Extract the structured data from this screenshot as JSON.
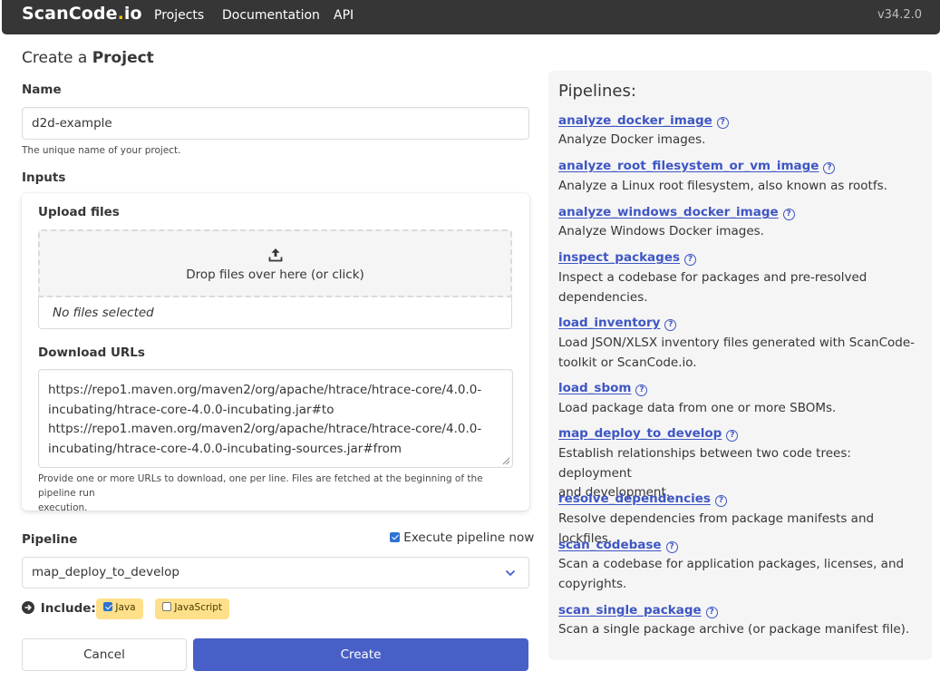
{
  "navbar": {
    "brand_main": "ScanCode",
    "brand_dot": ".",
    "brand_suffix": "io",
    "links": [
      "Projects",
      "Documentation",
      "API"
    ],
    "version": "v34.2.0"
  },
  "page": {
    "title_prefix": "Create a",
    "title_bold": "Project"
  },
  "form": {
    "name_label": "Name",
    "name_value": "d2d-example",
    "name_help": "The unique name of your project.",
    "inputs_label": "Inputs",
    "upload_label": "Upload files",
    "drop_text": "Drop files over here (or click)",
    "no_files": "No files selected",
    "download_label": "Download URLs",
    "urls_lines": [
      "https://repo1.maven.org/maven2/org/apache/htrace/htrace-core/4.0.0-",
      "incubating/htrace-core-4.0.0-incubating.jar#to",
      "https://repo1.maven.org/maven2/org/apache/htrace/htrace-core/4.0.0-",
      "incubating/htrace-core-4.0.0-incubating-sources.jar#from"
    ],
    "urls_help_1": "Provide one or more URLs to download, one per line. Files are fetched at the beginning of the pipeline run",
    "urls_help_2": "execution.",
    "pipeline_label": "Pipeline",
    "execute_label": "Execute pipeline now",
    "execute_checked": true,
    "pipeline_selected": "map_deploy_to_develop",
    "include_label": "Include:",
    "include_options": [
      {
        "label": "Java",
        "checked": true
      },
      {
        "label": "JavaScript",
        "checked": false
      }
    ],
    "cancel_label": "Cancel",
    "create_label": "Create"
  },
  "pipelines_panel": {
    "title": "Pipelines:",
    "items": [
      {
        "name": "analyze_docker_image",
        "desc": [
          "Analyze Docker images."
        ]
      },
      {
        "name": "analyze_root_filesystem_or_vm_image",
        "desc": [
          "Analyze a Linux root filesystem, also known as rootfs."
        ]
      },
      {
        "name": "analyze_windows_docker_image",
        "desc": [
          "Analyze Windows Docker images."
        ]
      },
      {
        "name": "inspect_packages",
        "desc": [
          "Inspect a codebase for packages and pre-resolved",
          "dependencies."
        ]
      },
      {
        "name": "load_inventory",
        "desc": [
          "Load JSON/XLSX inventory files generated with ScanCode-",
          "toolkit or ScanCode.io."
        ]
      },
      {
        "name": "load_sbom",
        "desc": [
          "Load package data from one or more SBOMs."
        ]
      },
      {
        "name": "map_deploy_to_develop",
        "desc": [
          "Establish relationships between two code trees: deployment",
          "and development."
        ]
      },
      {
        "name": "resolve_dependencies",
        "desc": [
          "Resolve dependencies from package manifests and lockfiles."
        ]
      },
      {
        "name": "scan_codebase",
        "desc": [
          "Scan a codebase for application packages, licenses, and",
          "copyrights."
        ]
      },
      {
        "name": "scan_single_package",
        "desc": [
          "Scan a single package archive (or package manifest file)."
        ]
      }
    ]
  },
  "colors": {
    "navbar_bg": "#363636",
    "brand_dot": "#f1c40f",
    "link": "#3e56c4",
    "primary_button": "#485fc7",
    "tag_bg": "#ffe08a",
    "panel_bg": "#f5f5f5"
  }
}
